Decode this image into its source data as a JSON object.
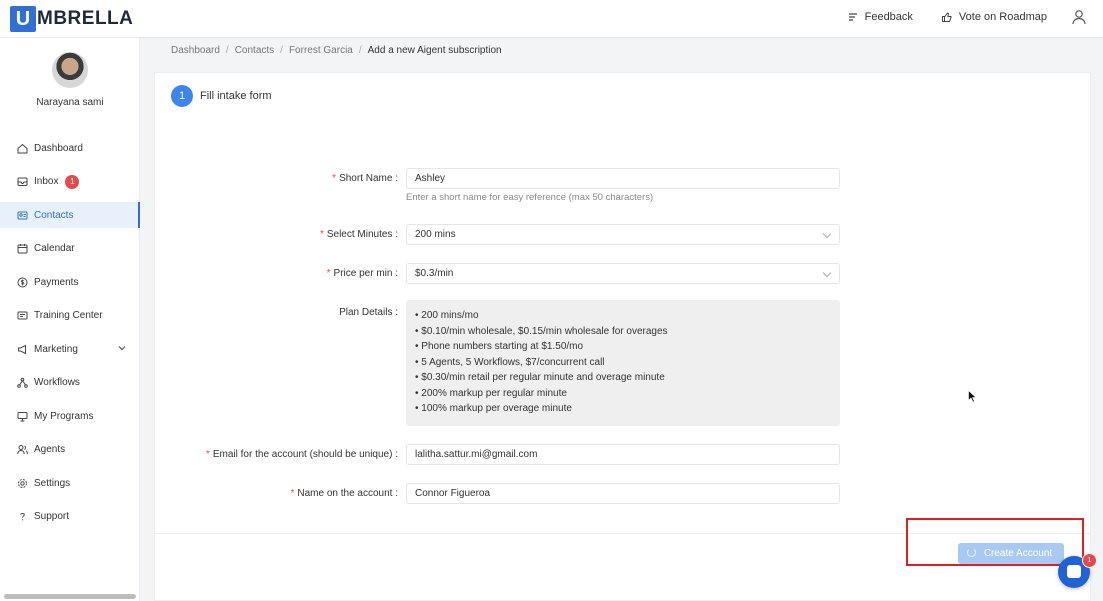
{
  "brand": {
    "logo_letter": "U",
    "logo_text": "MBRELLA",
    "accent": "#2f6fd6"
  },
  "topbar": {
    "feedback_label": "Feedback",
    "roadmap_label": "Vote on Roadmap"
  },
  "sidebar": {
    "user_name": "Narayana sami",
    "items": [
      {
        "label": "Dashboard",
        "icon": "home-icon"
      },
      {
        "label": "Inbox",
        "icon": "inbox-icon",
        "badge": "1"
      },
      {
        "label": "Contacts",
        "icon": "contacts-icon",
        "active": true
      },
      {
        "label": "Calendar",
        "icon": "calendar-icon"
      },
      {
        "label": "Payments",
        "icon": "payments-icon"
      },
      {
        "label": "Training Center",
        "icon": "training-icon"
      },
      {
        "label": "Marketing",
        "icon": "megaphone-icon",
        "expandable": true
      },
      {
        "label": "Workflows",
        "icon": "workflows-icon"
      },
      {
        "label": "My Programs",
        "icon": "monitor-icon"
      },
      {
        "label": "Agents",
        "icon": "agents-icon"
      },
      {
        "label": "Settings",
        "icon": "gear-icon"
      },
      {
        "label": "Support",
        "icon": "help-icon"
      }
    ]
  },
  "breadcrumb": {
    "items": [
      "Dashboard",
      "Contacts",
      "Forrest Garcia"
    ],
    "current": "Add a new Aigent subscription"
  },
  "step": {
    "number": "1",
    "label": "Fill intake form"
  },
  "form": {
    "short_name": {
      "label": "Short Name",
      "value": "Ashley",
      "hint": "Enter a short name for easy reference (max 50 characters)"
    },
    "select_minutes": {
      "label": "Select Minutes",
      "value": "200 mins"
    },
    "price_per_min": {
      "label": "Price per min",
      "value": "$0.3/min"
    },
    "plan_details": {
      "label": "Plan Details :",
      "lines": [
        "200 mins/mo",
        "$0.10/min wholesale, $0.15/min wholesale for overages",
        "Phone numbers starting at $1.50/mo",
        "5 Agents, 5 Workflows, $7/concurrent call",
        "$0.30/min retail per regular minute and overage minute",
        "200% markup per regular minute",
        "100% markup per overage minute"
      ]
    },
    "email": {
      "label": "Email for the account (should be unique)",
      "value": "lalitha.sattur.mi@gmail.com"
    },
    "account_name": {
      "label": "Name on the account",
      "value": "Connor Figueroa"
    }
  },
  "actions": {
    "create_account_label": "Create Account"
  },
  "chat": {
    "badge": "1"
  }
}
